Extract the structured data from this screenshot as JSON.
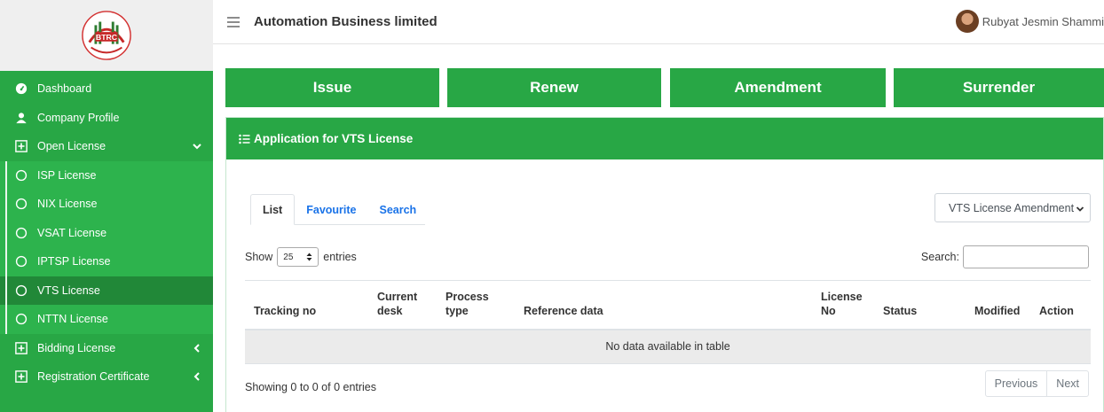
{
  "sidebar": {
    "logo_icon": "btrc-logo",
    "logo_text": "BTRC",
    "items": [
      {
        "label": "Dashboard",
        "icon": "dashboard-icon"
      },
      {
        "label": "Company Profile",
        "icon": "user-icon"
      },
      {
        "label": "Open License",
        "icon": "plus-square-icon"
      },
      {
        "label": "ISP License",
        "icon": "circle-icon"
      },
      {
        "label": "NIX License",
        "icon": "circle-icon"
      },
      {
        "label": "VSAT License",
        "icon": "circle-icon"
      },
      {
        "label": "IPTSP License",
        "icon": "circle-icon"
      },
      {
        "label": "VTS License",
        "icon": "circle-icon"
      },
      {
        "label": "NTTN License",
        "icon": "circle-icon"
      },
      {
        "label": "Bidding License",
        "icon": "plus-square-icon"
      },
      {
        "label": "Registration Certificate",
        "icon": "plus-square-icon"
      }
    ]
  },
  "header": {
    "company": "Automation Business limited",
    "user_name": "Rubyat Jesmin Shammi"
  },
  "actions": [
    "Issue",
    "Renew",
    "Amendment",
    "Surrender"
  ],
  "panel": {
    "title": "Application for VTS License",
    "tabs": [
      "List",
      "Favourite",
      "Search"
    ],
    "type_select_value": "VTS License Amendment",
    "show_label": "Show",
    "page_length": "25",
    "entries_label": "entries",
    "search_label": "Search:",
    "columns": [
      "Tracking no",
      "Current desk",
      "Process type",
      "Reference data",
      "License No",
      "Status",
      "Modified",
      "Action"
    ],
    "empty_message": "No data available in table",
    "info": "Showing 0 to 0 of 0 entries",
    "prev_label": "Previous",
    "next_label": "Next"
  },
  "colors": {
    "brand_green": "#28a745",
    "active_green": "#218838",
    "link_blue": "#1a73e8"
  }
}
